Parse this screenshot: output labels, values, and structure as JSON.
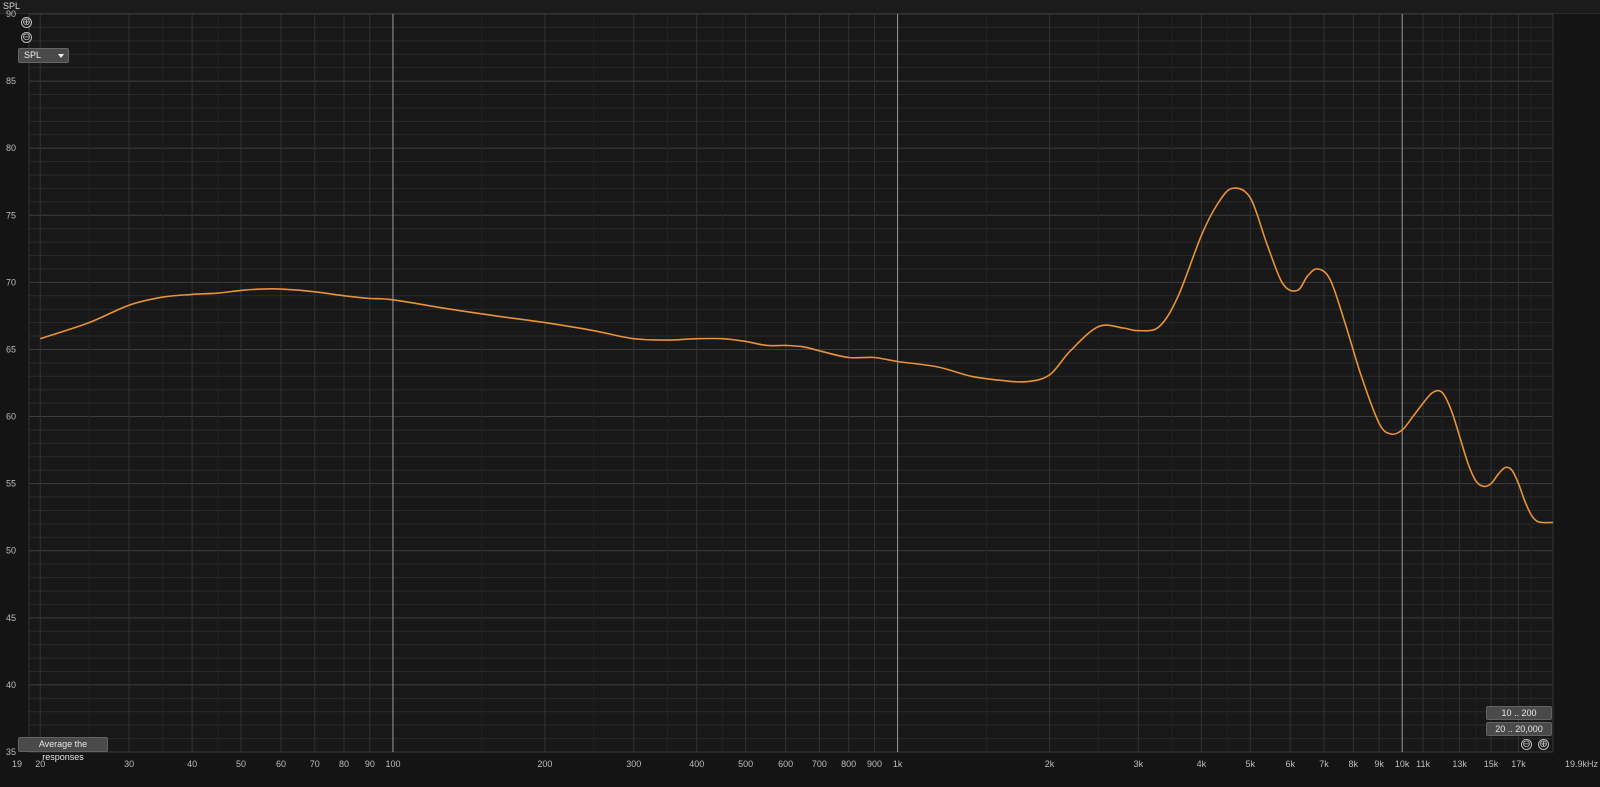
{
  "window": {
    "panel_title": "SPL"
  },
  "controls": {
    "zoom_in_symbol": "⊕",
    "zoom_out_symbol": "⊖",
    "plot_selector_value": "SPL",
    "average_button_label": "Average the responses",
    "range_buttons": [
      "10 .. 200",
      "20 .. 20,000"
    ]
  },
  "colors": {
    "background": "#141414",
    "grid_major": "#5a5a5a",
    "grid_minor": "#2b2b2b",
    "trace": "#e8923a"
  },
  "chart_data": {
    "type": "line",
    "title": "",
    "xlabel": "",
    "ylabel": "",
    "x_scale": "log",
    "xlim": [
      19,
      19900
    ],
    "ylim": [
      35,
      90
    ],
    "grid": true,
    "y_ticks": [
      35,
      40,
      45,
      50,
      55,
      60,
      65,
      70,
      75,
      80,
      85,
      90
    ],
    "x_ticks": [
      {
        "value": 19,
        "label": "19"
      },
      {
        "value": 20,
        "label": "20"
      },
      {
        "value": 30,
        "label": "30"
      },
      {
        "value": 40,
        "label": "40"
      },
      {
        "value": 50,
        "label": "50"
      },
      {
        "value": 60,
        "label": "60"
      },
      {
        "value": 70,
        "label": "70"
      },
      {
        "value": 80,
        "label": "80"
      },
      {
        "value": 90,
        "label": "90"
      },
      {
        "value": 100,
        "label": "100"
      },
      {
        "value": 200,
        "label": "200"
      },
      {
        "value": 300,
        "label": "300"
      },
      {
        "value": 400,
        "label": "400"
      },
      {
        "value": 500,
        "label": "500"
      },
      {
        "value": 600,
        "label": "600"
      },
      {
        "value": 700,
        "label": "700"
      },
      {
        "value": 800,
        "label": "800"
      },
      {
        "value": 900,
        "label": "900"
      },
      {
        "value": 1000,
        "label": "1k"
      },
      {
        "value": 2000,
        "label": "2k"
      },
      {
        "value": 3000,
        "label": "3k"
      },
      {
        "value": 4000,
        "label": "4k"
      },
      {
        "value": 5000,
        "label": "5k"
      },
      {
        "value": 6000,
        "label": "6k"
      },
      {
        "value": 7000,
        "label": "7k"
      },
      {
        "value": 8000,
        "label": "8k"
      },
      {
        "value": 9000,
        "label": "9k"
      },
      {
        "value": 10000,
        "label": "10k"
      },
      {
        "value": 11000,
        "label": "11k"
      },
      {
        "value": 13000,
        "label": "13k"
      },
      {
        "value": 15000,
        "label": "15k"
      },
      {
        "value": 17000,
        "label": "17k"
      },
      {
        "value": 19900,
        "label": "19.9kHz"
      }
    ],
    "series": [
      {
        "x": [
          20,
          25,
          30,
          35,
          40,
          45,
          50,
          55,
          60,
          70,
          80,
          90,
          100,
          130,
          160,
          200,
          250,
          300,
          350,
          400,
          450,
          500,
          550,
          600,
          650,
          700,
          800,
          900,
          1000,
          1200,
          1400,
          1600,
          1800,
          2000,
          2200,
          2500,
          2800,
          3000,
          3300,
          3600,
          4000,
          4300,
          4600,
          5000,
          5400,
          5800,
          6200,
          6500,
          6800,
          7200,
          7700,
          8300,
          9000,
          9500,
          10000,
          10500,
          11000,
          11500,
          12000,
          12500,
          13000,
          13500,
          14000,
          14500,
          15000,
          15500,
          16000,
          16500,
          17000,
          17500,
          18000,
          18500,
          19000,
          19500,
          19900
        ],
        "y": [
          65.8,
          67.0,
          68.3,
          68.9,
          69.1,
          69.2,
          69.4,
          69.5,
          69.5,
          69.3,
          69.0,
          68.8,
          68.7,
          68.0,
          67.5,
          67.0,
          66.4,
          65.8,
          65.7,
          65.8,
          65.8,
          65.6,
          65.3,
          65.3,
          65.2,
          64.9,
          64.4,
          64.4,
          64.1,
          63.7,
          63.0,
          62.7,
          62.6,
          63.1,
          64.9,
          66.7,
          66.6,
          66.4,
          66.7,
          69.0,
          73.5,
          75.8,
          77.0,
          76.3,
          72.8,
          69.9,
          69.4,
          70.5,
          71.0,
          70.2,
          67.0,
          63.0,
          59.5,
          58.7,
          59.0,
          60.0,
          61.0,
          61.8,
          61.8,
          60.5,
          58.5,
          56.5,
          55.2,
          54.8,
          55.0,
          55.7,
          56.2,
          56.0,
          55.0,
          53.7,
          52.7,
          52.2,
          52.1,
          52.1,
          52.1
        ]
      }
    ]
  }
}
